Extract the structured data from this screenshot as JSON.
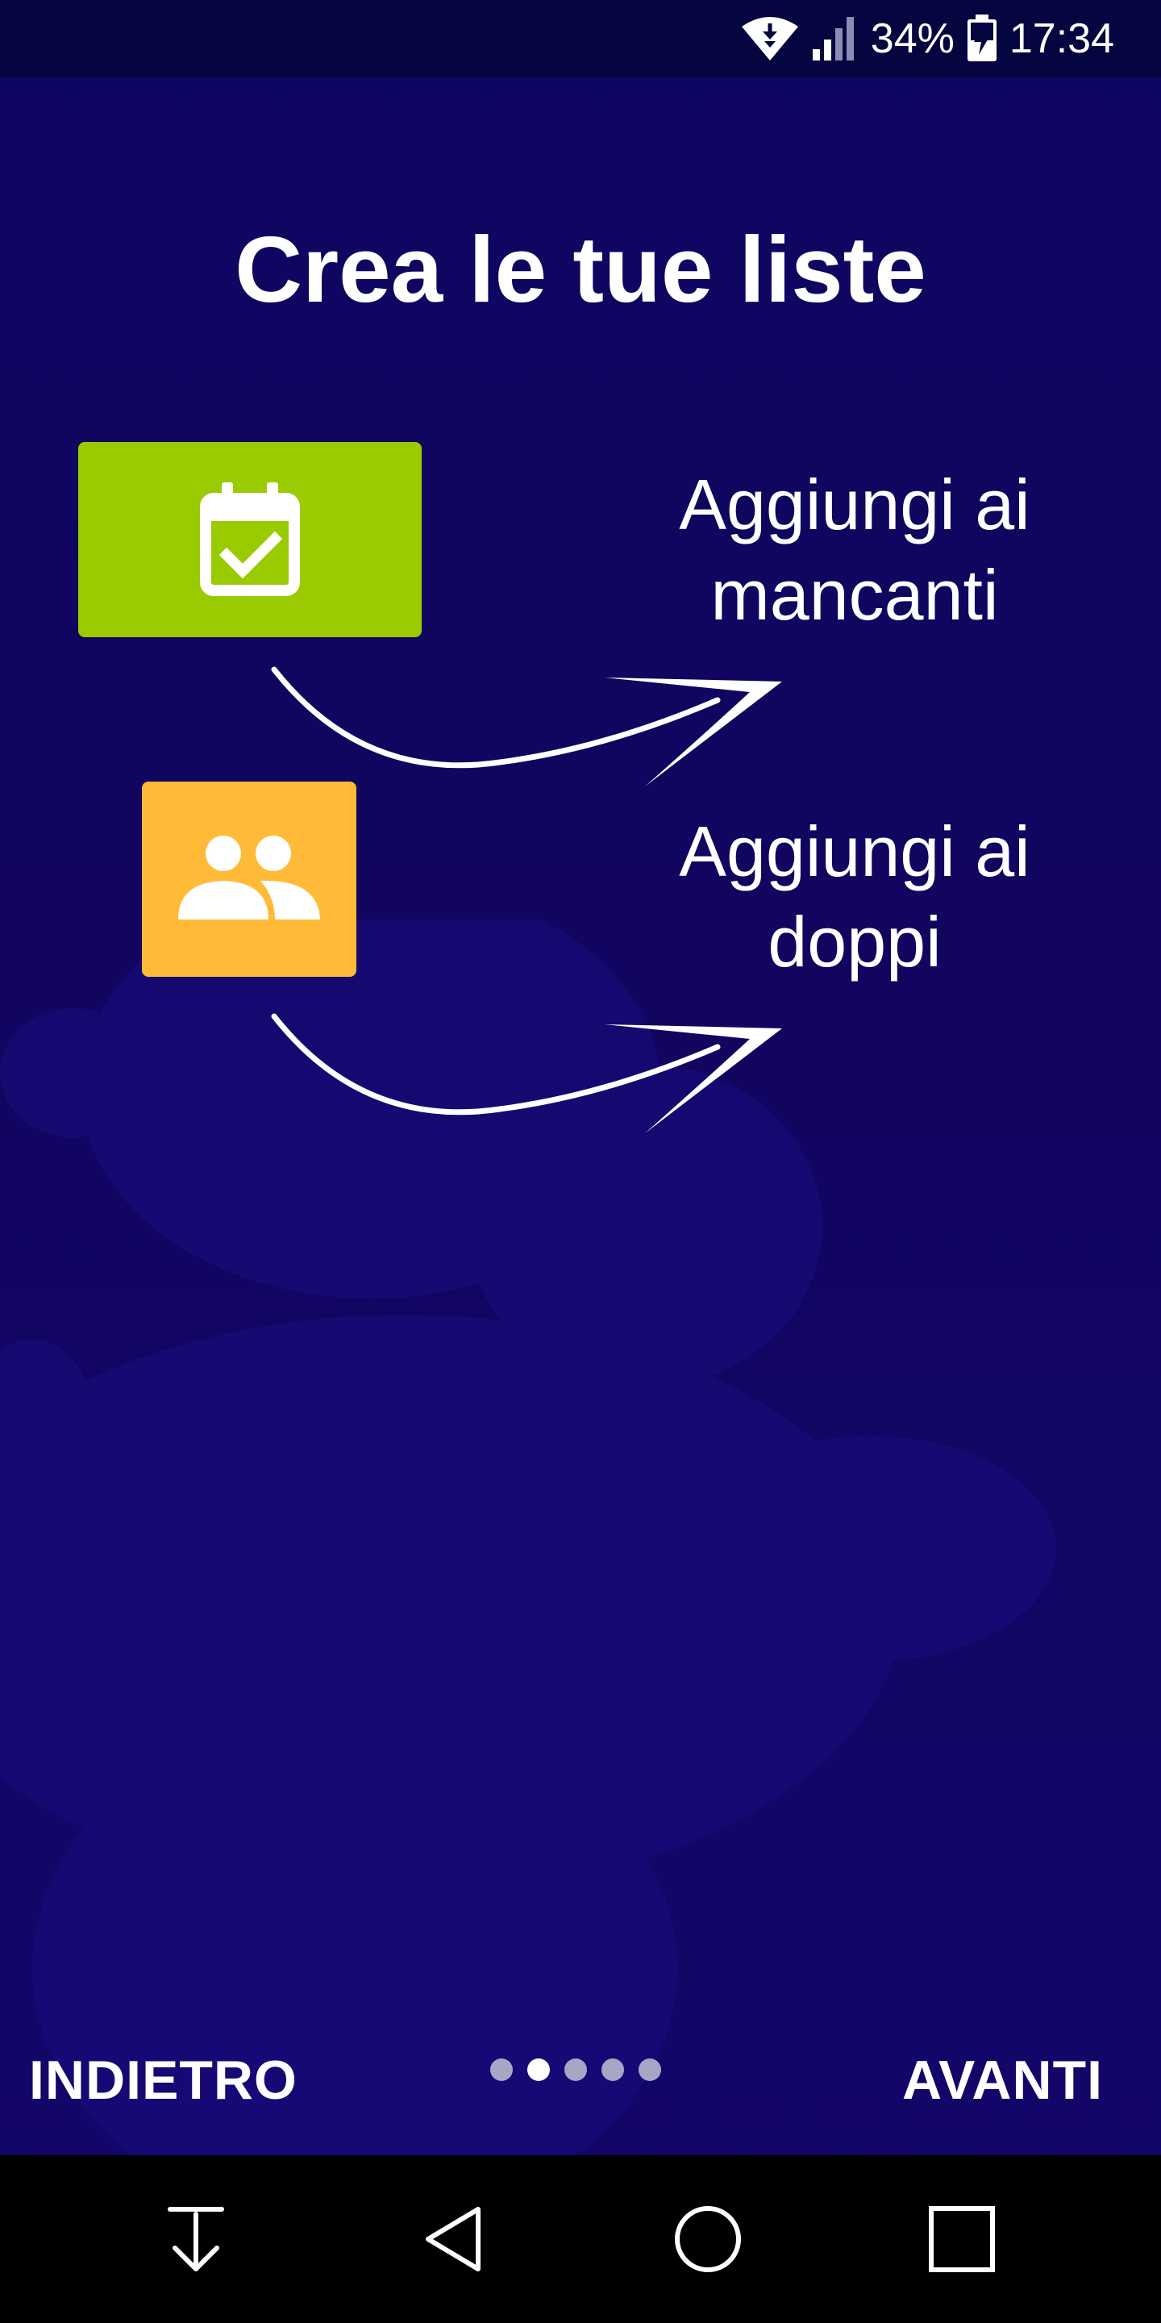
{
  "status_bar": {
    "battery_percent": "34%",
    "time": "17:34",
    "icons": [
      "wifi-icon",
      "signal-icon",
      "battery-charging-icon"
    ]
  },
  "onboarding": {
    "title": "Crea le tue liste",
    "features": [
      {
        "icon": "calendar-check-icon",
        "color": "#9acb00",
        "label": "Aggiungi ai mancanti"
      },
      {
        "icon": "people-icon",
        "color": "#ffbb37",
        "label": "Aggiungi ai doppi"
      }
    ],
    "pager": {
      "back_label": "INDIETRO",
      "next_label": "AVANTI",
      "page_count": 5,
      "current_page": 2
    }
  },
  "navigation_bar": {
    "icons": [
      "download-icon",
      "back-icon",
      "home-icon",
      "recents-icon"
    ]
  },
  "colors": {
    "background": "#11055f",
    "status_bar": "#050640",
    "missing_tile": "#9acb00",
    "doubles_tile": "#ffbb37",
    "nav_bar": "#000000"
  }
}
